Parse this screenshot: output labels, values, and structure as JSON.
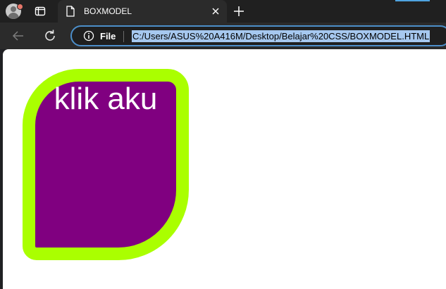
{
  "browser": {
    "tab": {
      "title": "BOXMODEL"
    },
    "omnibox": {
      "security_label": "File",
      "url": "C:/Users/ASUS%20A416M/Desktop/Belajar%20CSS/BOXMODEL.HTML"
    },
    "icons": {
      "profile": "profile-avatar-icon",
      "tab_actions": "tab-actions-icon",
      "favicon": "page-icon",
      "close": "close-icon",
      "new_tab": "plus-icon",
      "back": "back-arrow-icon",
      "reload": "reload-icon",
      "info": "info-icon"
    }
  },
  "page": {
    "box_text": "klik aku",
    "colors": {
      "box_background": "#800080",
      "box_border": "#aaff00",
      "box_text": "#ffffff",
      "page_background": "#ffffff",
      "url_selection": "#a6c8ef"
    }
  }
}
